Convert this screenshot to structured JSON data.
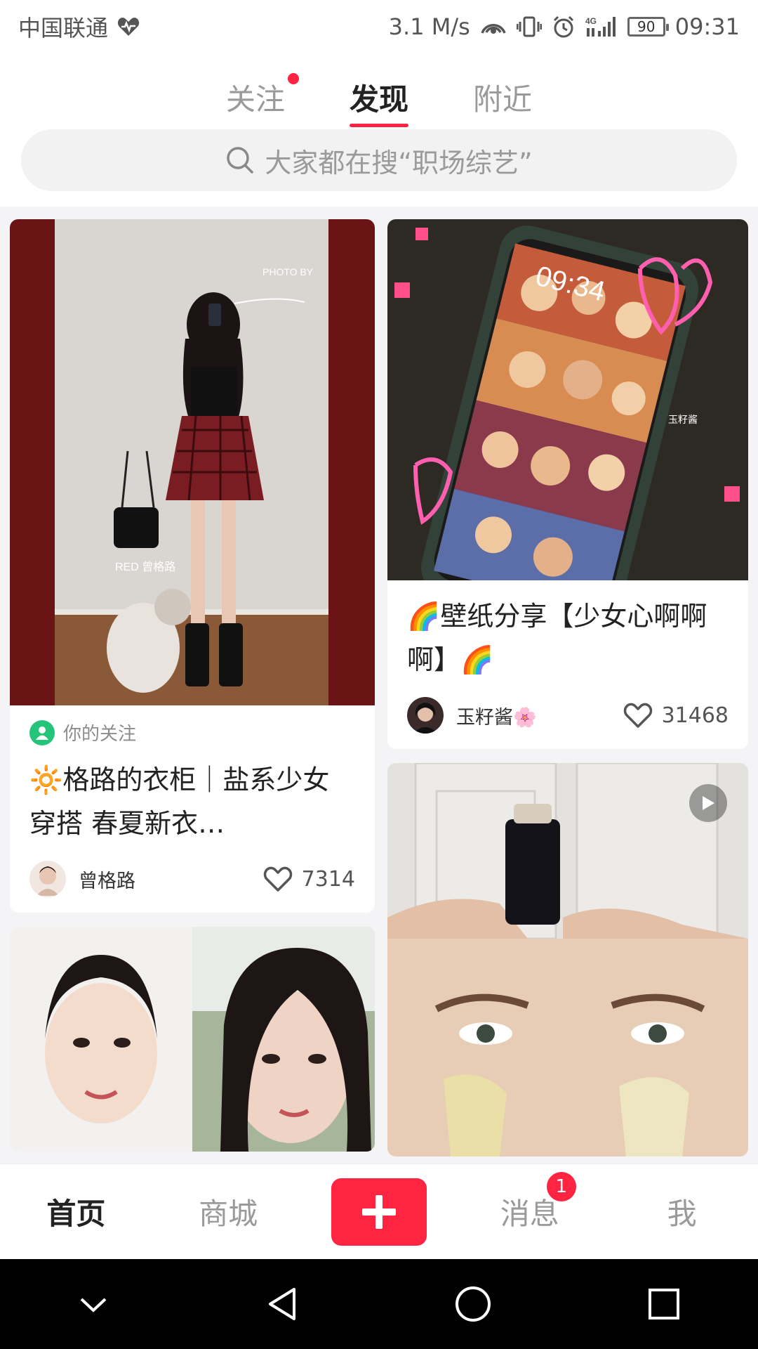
{
  "status_bar": {
    "carrier": "中国联通",
    "speed": "3.1 M/s",
    "battery": "90",
    "time": "09:31"
  },
  "tabs": [
    {
      "label": "关注"
    },
    {
      "label": "发现"
    },
    {
      "label": "附近"
    }
  ],
  "search": {
    "placeholder": "大家都在搜“职场综艺”"
  },
  "cards": {
    "left1": {
      "follow_tag": "你的关注",
      "title": "🔆格路的衣柜｜盐系少女穿搭 春夏新衣…",
      "author": "曾格路",
      "likes": "7314"
    },
    "right1": {
      "title": "🌈壁纸分享【少女心啊啊啊】🌈",
      "author": "玉籽酱🌸",
      "likes": "31468"
    }
  },
  "bottom_nav": {
    "home": "首页",
    "mall": "商城",
    "messages": "消息",
    "messages_badge": "1",
    "me": "我"
  },
  "colors": {
    "accent": "#ff2442",
    "follow_green": "#24c47a"
  }
}
